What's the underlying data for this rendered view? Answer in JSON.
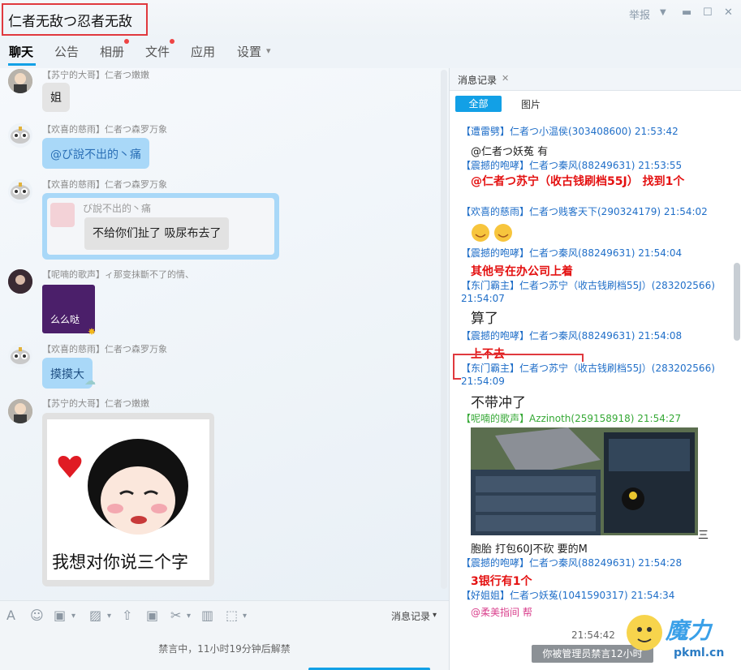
{
  "window": {
    "title": "仁者无敌つ忍者无敌",
    "report_label": "举报",
    "dropdown_glyph": "▼",
    "min_glyph": "▬",
    "max_glyph": "☐",
    "close_glyph": "✕"
  },
  "tabs": [
    {
      "label": "聊天"
    },
    {
      "label": "公告"
    },
    {
      "label": "相册"
    },
    {
      "label": "文件"
    },
    {
      "label": "应用"
    },
    {
      "label": "设置"
    }
  ],
  "tabs_settings_arrow": "▾",
  "chat": {
    "messages": [
      {
        "sender": "【苏宁的大哥】仁者つ嫩嫩",
        "text": "姐"
      },
      {
        "sender": "【欢喜的慈雨】仁者つ森罗万象",
        "text": "@び說不出的丶痛"
      },
      {
        "sender": "【欢喜的慈雨】仁者つ森罗万象",
        "quote_name": "び說不出的丶痛",
        "text": "不给你们扯了 吸尿布去了"
      },
      {
        "sender": "【呢喃的歌声】ィ那变抹斷不了的情、",
        "text": "么么哒"
      },
      {
        "sender": "【欢喜的慈雨】仁者つ森罗万象",
        "text": "摸摸大"
      },
      {
        "sender": "【苏宁的大哥】仁者つ嫩嫩",
        "sticker_text": "我想对你说三个字"
      }
    ]
  },
  "toolbar": {
    "font_icon": "A",
    "emoji_icon": "☺",
    "gift_icon": "▣",
    "image_icon": "▨",
    "upload_icon": "⇧",
    "screenshot_icon": "✂",
    "trash_icon": "▥",
    "more_icon": "⬚",
    "arrow": "▾",
    "history_label": "消息记录"
  },
  "input": {
    "mute_notice": "禁言中，11小时19分钟后解禁"
  },
  "history": {
    "tab_label": "消息记录",
    "tab_close": "✕",
    "filter_all": "全部",
    "filter_images": "图片",
    "entries": [
      {
        "header": "【遭雷劈】仁者つ小温侯(303408600) 21:53:42",
        "body": "@仁者つ妖菟 有"
      },
      {
        "header": "【震撼的咆哮】仁者つ秦风(88249631) 21:53:55",
        "body": "@仁者つ苏宁（收古钱刷档55J） 找到1个"
      },
      {
        "header": "【欢喜的慈雨】仁者つ贱客天下(290324179) 21:54:02",
        "body": ""
      },
      {
        "header": "【震撼的咆哮】仁者つ秦风(88249631) 21:54:04",
        "body": "其他号在办公司上着"
      },
      {
        "header": "【东门霸主】仁者つ苏宁（收古钱刷档55J）(283202566) 21:54:07",
        "body": "算了"
      },
      {
        "header": "【震撼的咆哮】仁者つ秦风(88249631) 21:54:08",
        "body": "上不去"
      },
      {
        "header": "【东门霸主】仁者つ苏宁（收古钱刷档55J）(283202566) 21:54:09",
        "body": "不带冲了"
      },
      {
        "header": "【呢喃的歌声】Azzinoth(259158918) 21:54:27",
        "body": "胞胎 打包60J不砍 要的M"
      },
      {
        "header": "【震撼的咆哮】仁者つ秦风(88249631) 21:54:28",
        "body": "3银行有1个"
      },
      {
        "header": "【好姐姐】仁者つ妖菟(1041590317) 21:54:34",
        "body": "@柔美指间 帮"
      }
    ],
    "image_trailing_text": "三",
    "footer_time": "21:54:42",
    "toast": "你被管理员禁言12小时"
  },
  "watermark": {
    "brand": "魔力",
    "site": "pkml.cn"
  },
  "colors": {
    "accent": "#12a0e6",
    "highlight_border": "#e0393e",
    "log_blue": "#1f6ec8",
    "alert_red": "#e41111"
  }
}
